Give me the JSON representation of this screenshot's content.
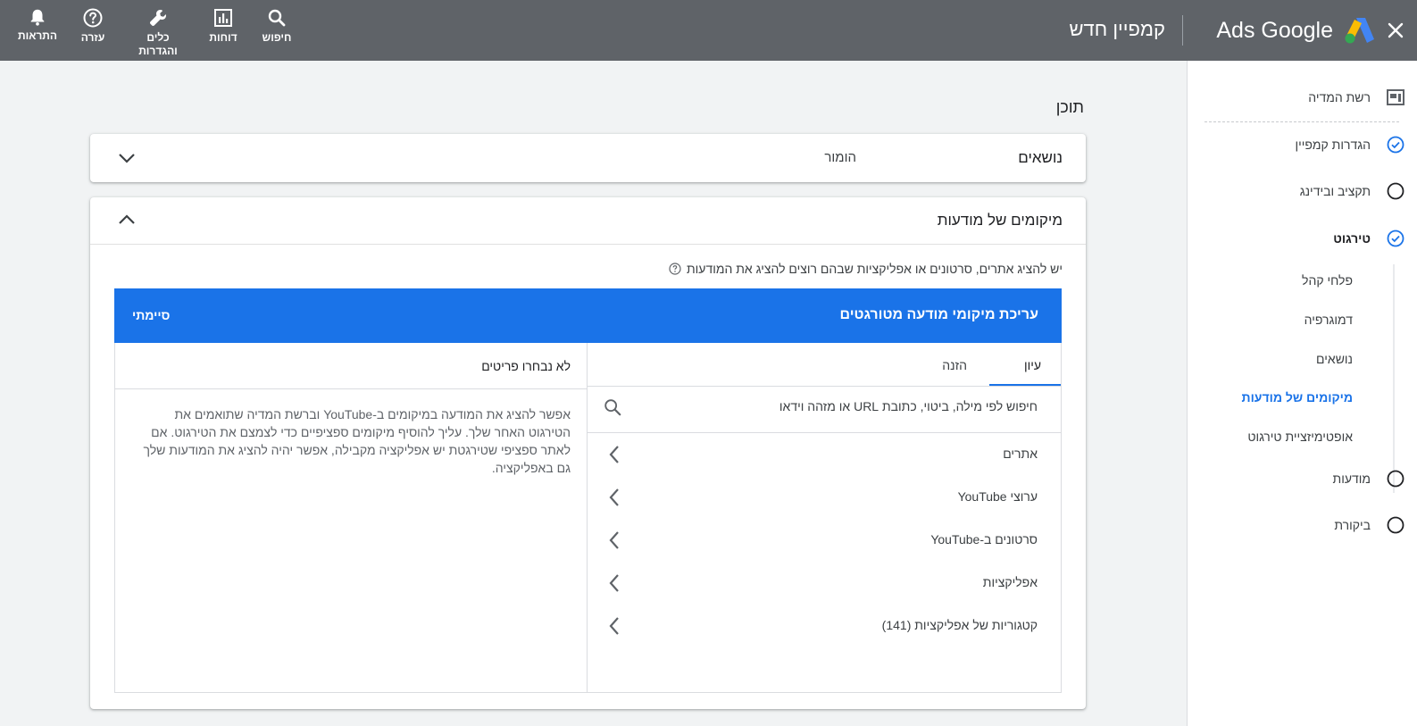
{
  "header": {
    "brand_name": "Ads Google",
    "campaign_title": "קמפיין חדש",
    "actions": [
      {
        "label": "חיפוש",
        "icon": "search-icon"
      },
      {
        "label": "דוחות",
        "icon": "reports-icon"
      },
      {
        "label": "כלים והגדרות",
        "icon": "wrench-icon"
      },
      {
        "label": "עזרה",
        "icon": "help-icon"
      },
      {
        "label": "התראות",
        "icon": "bell-icon"
      }
    ]
  },
  "sidebar": {
    "campaign_type": "רשת המדיה",
    "steps": [
      {
        "label": "הגדרות קמפיין",
        "status": "done"
      },
      {
        "label": "תקציב ובידינג",
        "status": "todo"
      },
      {
        "label": "טירגוט",
        "status": "done"
      },
      {
        "label": "מודעות",
        "status": "todo"
      },
      {
        "label": "ביקורת",
        "status": "todo"
      }
    ],
    "sub_steps": [
      {
        "label": "פלחי קהל"
      },
      {
        "label": "דמוגרפיה"
      },
      {
        "label": "נושאים"
      },
      {
        "label": "מיקומים של מודעות",
        "active": true
      },
      {
        "label": "אופטימיזציית טירגוט"
      }
    ]
  },
  "main": {
    "title": "תוכן",
    "topics_card": {
      "heading": "נושאים",
      "value": "הומור"
    },
    "placements_card": {
      "heading": "מיקומים של מודעות",
      "instruction": "יש להציג אתרים, סרטונים או אפליקציות שבהם רוצים להציג את המודעות",
      "edit_bar": {
        "title": "עריכת מיקומי מודעה מטורגטים",
        "done_label": "סיימתי"
      },
      "tabs": [
        {
          "label": "עיון",
          "active": true
        },
        {
          "label": "הזנה"
        }
      ],
      "search_placeholder": "חיפוש לפי מילה, ביטוי, כתובת URL או מזהה וידאו",
      "categories": [
        {
          "label": "אתרים"
        },
        {
          "label": "ערוצי YouTube"
        },
        {
          "label": "סרטונים ב-YouTube"
        },
        {
          "label": "אפליקציות"
        },
        {
          "label": "קטגוריות של אפליקציות (141)"
        }
      ],
      "selected_panel": {
        "title": "לא נבחרו פריטים",
        "body": "אפשר להציג את המודעה במיקומים ב-YouTube וברשת המדיה שתואמים את הטירגוט האחר שלך. עליך להוסיף מיקומים ספציפיים כדי לצמצם את הטירגוט. אם לאתר ספציפי שטירגטת יש אפליקציה מקבילה, אפשר יהיה להציג את המודעות שלך גם באפליקציה."
      }
    }
  },
  "colors": {
    "header_bg": "#5f6368",
    "accent": "#1a73e8",
    "page_bg": "#f1f3f4"
  }
}
